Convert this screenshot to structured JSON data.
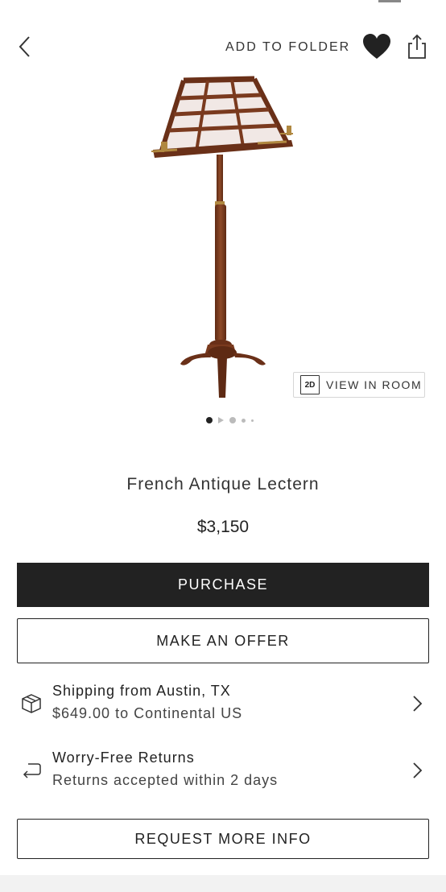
{
  "header": {
    "add_to_folder_label": "ADD TO FOLDER",
    "back_icon": "chevron-left-icon",
    "favorite_icon": "heart-icon",
    "share_icon": "share-icon"
  },
  "gallery": {
    "view_in_room_badge": "2D",
    "view_in_room_label": "VIEW IN ROOM",
    "pager": {
      "count": 5,
      "active_index": 0
    }
  },
  "product": {
    "title": "French Antique Lectern",
    "price": "$3,150"
  },
  "actions": {
    "purchase_label": "PURCHASE",
    "offer_label": "MAKE AN OFFER",
    "request_info_label": "REQUEST MORE INFO"
  },
  "shipping": {
    "title": "Shipping from Austin, TX",
    "detail": "$649.00 to Continental US",
    "icon": "package-icon"
  },
  "returns": {
    "title": "Worry-Free Returns",
    "detail": "Returns accepted within 2 days",
    "icon": "return-arrow-icon"
  },
  "colors": {
    "primary_button": "#222222",
    "text": "#222222",
    "wood": "#7a3a1e"
  }
}
